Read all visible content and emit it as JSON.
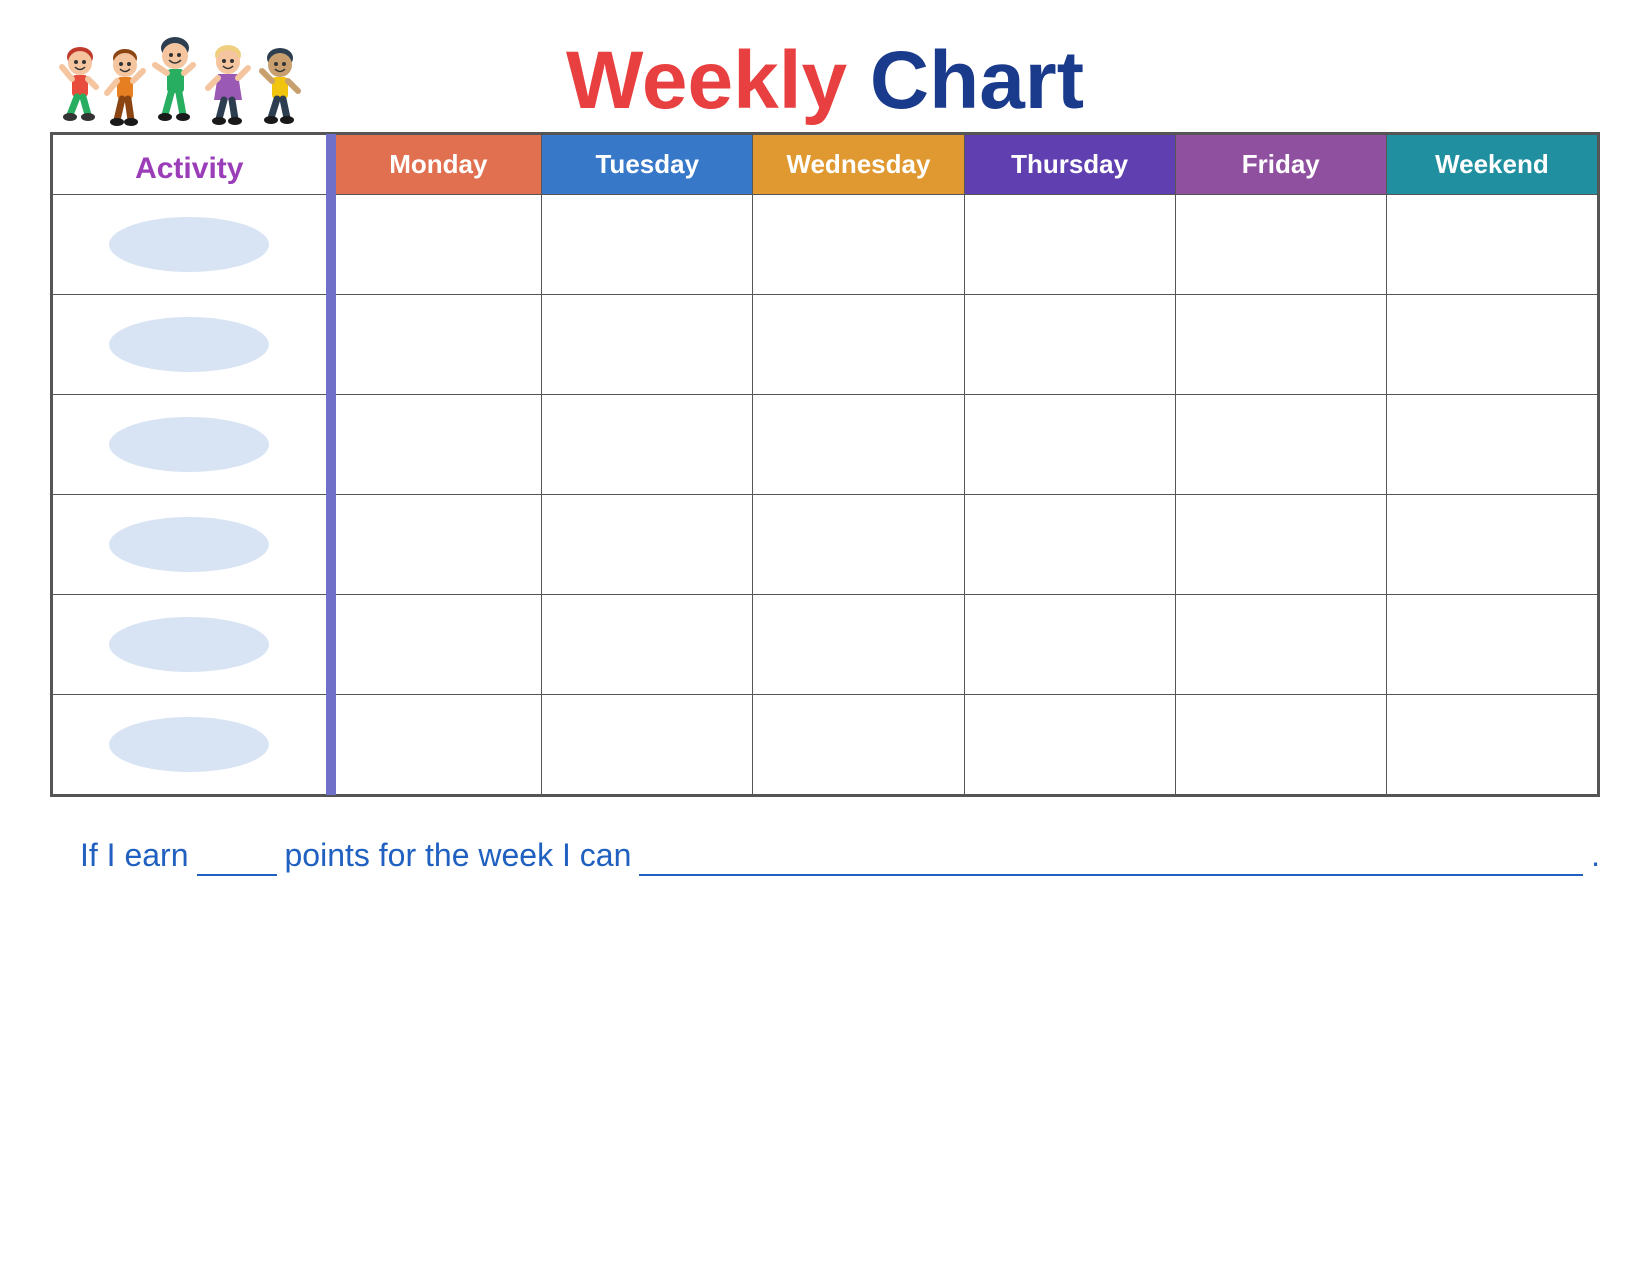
{
  "title": {
    "weekly": "Weekly",
    "chart": "Chart"
  },
  "activity_label": "Activity",
  "days": [
    "Monday",
    "Tuesday",
    "Wednesday",
    "Thursday",
    "Friday",
    "Weekend"
  ],
  "day_classes": [
    "th-monday",
    "th-tuesday",
    "th-wednesday",
    "th-thursday",
    "th-friday",
    "th-weekend"
  ],
  "rows": 6,
  "footer": {
    "text1": "If I earn",
    "text2": "points for the week I can",
    "period": "."
  }
}
